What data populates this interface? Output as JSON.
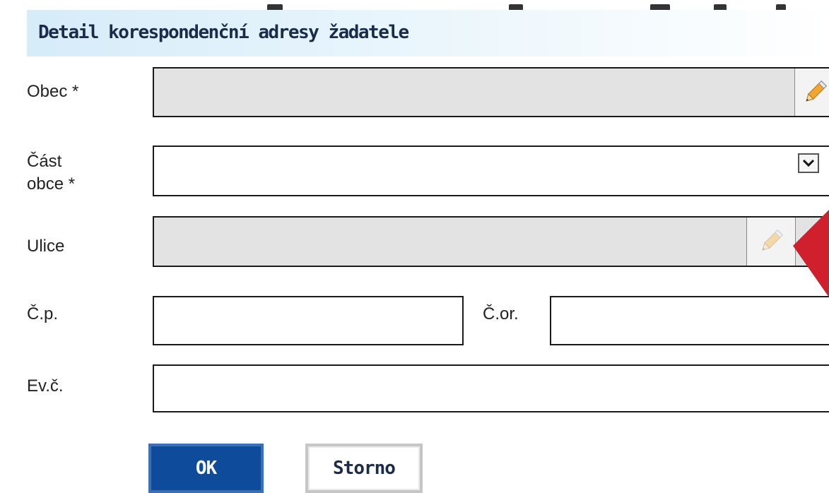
{
  "header": {
    "title": "Detail korespondenční adresy žadatele"
  },
  "form": {
    "obec": {
      "label": "Obec *",
      "value": ""
    },
    "cast_obce": {
      "label_line1": "Část",
      "label_line2": "obce *",
      "value": ""
    },
    "ulice": {
      "label": "Ulice",
      "value": ""
    },
    "cp": {
      "label": "Č.p.",
      "value": ""
    },
    "cor": {
      "label": "Č.or.",
      "value": ""
    },
    "evc": {
      "label": "Ev.č.",
      "value": ""
    }
  },
  "buttons": {
    "ok": "OK",
    "storno": "Storno"
  },
  "icons": {
    "obec_edit": "pencil-icon",
    "ulice_edit": "pencil-icon",
    "cast_obce_dropdown": "chevron-down-icon",
    "annotation": "arrow-pointer-icon"
  },
  "colors": {
    "ok_button": "#0e4b9a",
    "header_gradient": "#d6ecf9",
    "annotation_arrow": "#d0202e"
  }
}
